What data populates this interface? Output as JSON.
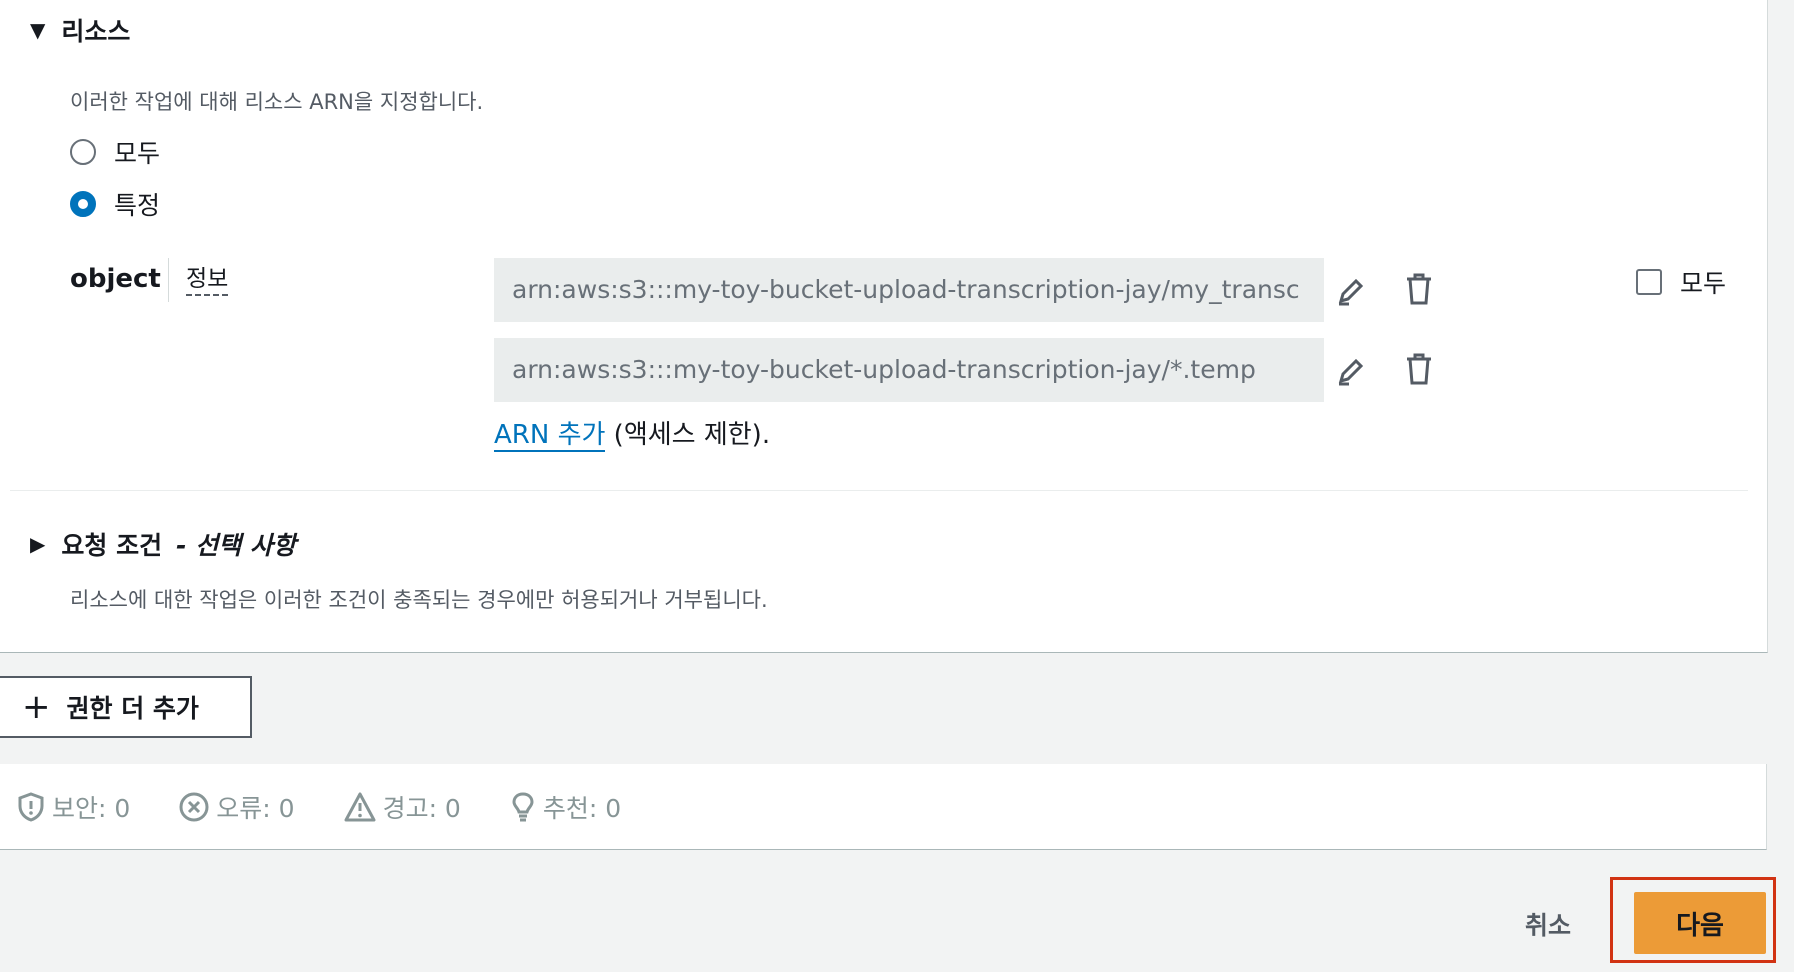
{
  "resources": {
    "header": "리소스",
    "description": "이러한 작업에 대해 리소스 ARN을 지정합니다.",
    "options": [
      {
        "label": "모두",
        "selected": false
      },
      {
        "label": "특정",
        "selected": true
      }
    ],
    "object_label": "object",
    "info_label": "정보",
    "arns": [
      "arn:aws:s3:::my-toy-bucket-upload-transcription-jay/my_transc",
      "arn:aws:s3:::my-toy-bucket-upload-transcription-jay/*.temp"
    ],
    "all_checkbox_label": "모두",
    "add_arn_link": "ARN 추가",
    "add_arn_suffix": " (액세스 제한)."
  },
  "conditions": {
    "header": "요청 조건",
    "header_suffix": "- 선택 사항",
    "description": "리소스에 대한 작업은 이러한 조건이 충족되는 경우에만 허용되거나 거부됩니다."
  },
  "add_permissions_button": "권한 더 추가",
  "status": {
    "security": "보안: 0",
    "errors": "오류: 0",
    "warnings": "경고: 0",
    "suggestions": "추천: 0"
  },
  "footer": {
    "cancel": "취소",
    "next": "다음"
  },
  "colors": {
    "accent": "#0073bb",
    "primary_button": "#ec9b37",
    "highlight_outline": "#d13212"
  }
}
